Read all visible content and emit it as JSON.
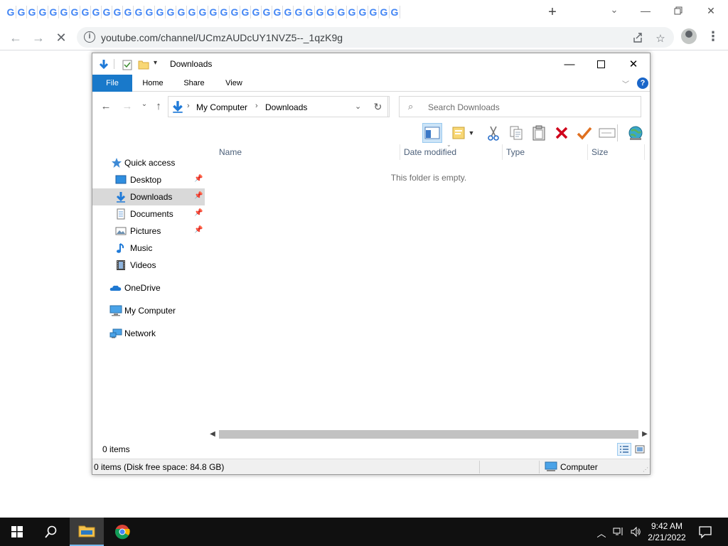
{
  "browser": {
    "tab_favicon_letter": "G",
    "tab_count": 37,
    "new_tab_label": "+",
    "url": "youtube.com/channel/UCmzAUDcUY1NVZ5--_1qzK9g",
    "info_icon": "i"
  },
  "explorer": {
    "title": "Downloads",
    "ribbon_tabs": [
      "File",
      "Home",
      "Share",
      "View"
    ],
    "help_label": "?",
    "breadcrumb": [
      "My Computer",
      "Downloads"
    ],
    "search_placeholder": "Search Downloads",
    "columns": [
      "Name",
      "Date modified",
      "Type",
      "Size"
    ],
    "empty_message": "This folder is empty.",
    "nav": {
      "quick_access": "Quick access",
      "items": [
        {
          "label": "Desktop",
          "icon": "desktop-icon",
          "pinned": true
        },
        {
          "label": "Downloads",
          "icon": "downloads-icon",
          "pinned": true,
          "selected": true
        },
        {
          "label": "Documents",
          "icon": "documents-icon",
          "pinned": true
        },
        {
          "label": "Pictures",
          "icon": "pictures-icon",
          "pinned": true
        },
        {
          "label": "Music",
          "icon": "music-icon",
          "pinned": false
        },
        {
          "label": "Videos",
          "icon": "videos-icon",
          "pinned": false
        }
      ],
      "onedrive": "OneDrive",
      "computer": "My Computer",
      "network": "Network"
    },
    "item_count": "0 items",
    "status_text": "0 items (Disk free space: 84.8 GB)",
    "status_location": "Computer"
  },
  "taskbar": {
    "time": "9:42 AM",
    "date": "2/21/2022"
  },
  "colors": {
    "accent": "#1979ca",
    "taskbar": "#101010",
    "delete_red": "#d0021b",
    "check_orange": "#e07020"
  }
}
